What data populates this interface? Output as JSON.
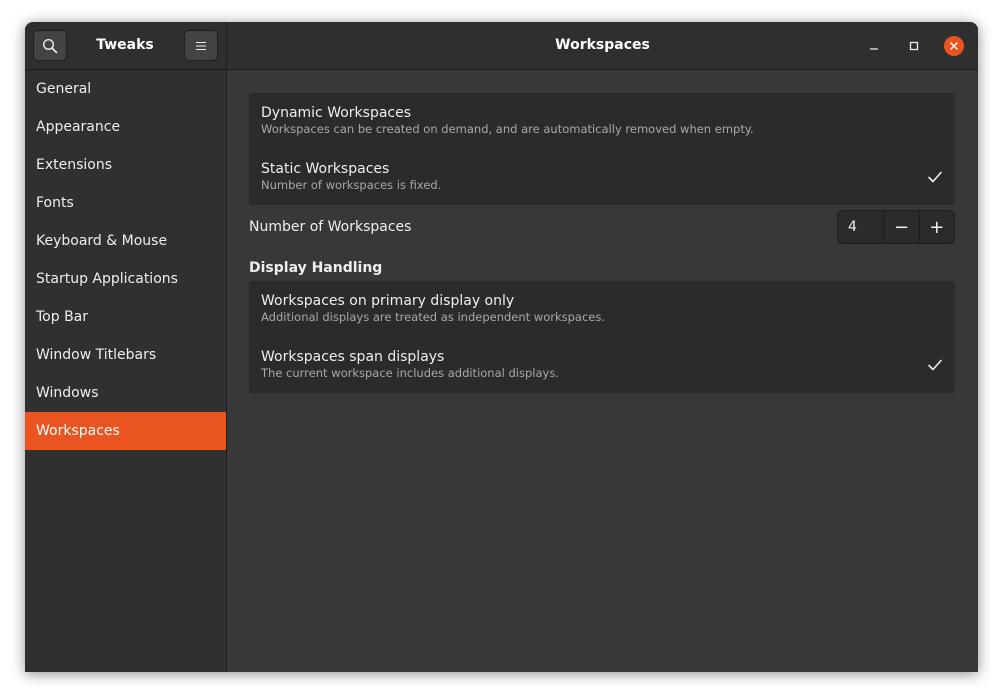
{
  "header": {
    "app_title": "Tweaks",
    "page_title": "Workspaces",
    "search_icon": "search-icon",
    "menu_icon": "hamburger-menu-icon"
  },
  "window_controls": {
    "minimize": "minimize-icon",
    "maximize": "maximize-icon",
    "close": "close-icon",
    "close_color": "#e95420"
  },
  "sidebar": {
    "items": [
      {
        "label": "General"
      },
      {
        "label": "Appearance"
      },
      {
        "label": "Extensions"
      },
      {
        "label": "Fonts"
      },
      {
        "label": "Keyboard & Mouse"
      },
      {
        "label": "Startup Applications"
      },
      {
        "label": "Top Bar"
      },
      {
        "label": "Window Titlebars"
      },
      {
        "label": "Windows"
      },
      {
        "label": "Workspaces",
        "active": true
      }
    ],
    "active_color": "#e95420"
  },
  "workspaces": {
    "options": [
      {
        "title": "Dynamic Workspaces",
        "subtitle": "Workspaces can be created on demand, and are automatically removed when empty.",
        "checked": false
      },
      {
        "title": "Static Workspaces",
        "subtitle": "Number of workspaces is fixed.",
        "checked": true
      }
    ],
    "count_label": "Number of Workspaces",
    "count_value": "4",
    "decrement_label": "−",
    "increment_label": "+"
  },
  "display_handling": {
    "heading": "Display Handling",
    "options": [
      {
        "title": "Workspaces on primary display only",
        "subtitle": "Additional displays are treated as independent workspaces.",
        "checked": false
      },
      {
        "title": "Workspaces span displays",
        "subtitle": "The current workspace includes additional displays.",
        "checked": true
      }
    ]
  }
}
